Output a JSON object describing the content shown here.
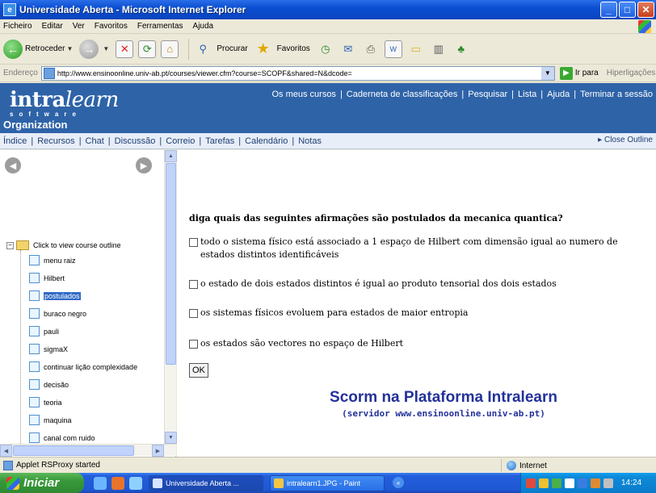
{
  "window": {
    "title": "Universidade Aberta - Microsoft Internet Explorer",
    "buttons": {
      "minimize": "_",
      "maximize": "□",
      "close": "✕"
    }
  },
  "menu": [
    "Ficheiro",
    "Editar",
    "Ver",
    "Favoritos",
    "Ferramentas",
    "Ajuda"
  ],
  "toolbar": {
    "back": "Retroceder",
    "search": "Procurar",
    "favorites": "Favoritos"
  },
  "address": {
    "label": "Endereço",
    "url": "http://www.ensinoonline.univ-ab.pt/courses/viewer.cfm?course=SCOPF&shared=N&dcode=",
    "go": "Ir para",
    "links": "Hiperligações"
  },
  "header": {
    "logo_main": "intra",
    "logo_italic": "learn",
    "logo_sub": "software",
    "section": "Organization",
    "nav": [
      "Os meus cursos",
      "Caderneta de classificações",
      "Pesquisar",
      "Lista",
      "Ajuda",
      "Terminar a sessão"
    ]
  },
  "toolnav": {
    "items": [
      "Índice",
      "Recursos",
      "Chat",
      "Discussão",
      "Correio",
      "Tarefas",
      "Calendário",
      "Notas"
    ],
    "close_outline": "Close Outline"
  },
  "outline": {
    "root": "Click to view course outline",
    "items": [
      {
        "label": "menu raiz",
        "selected": false
      },
      {
        "label": "Hilbert",
        "selected": false
      },
      {
        "label": "postulados",
        "selected": true
      },
      {
        "label": "buraco negro",
        "selected": false
      },
      {
        "label": "pauli",
        "selected": false
      },
      {
        "label": "sigmaX",
        "selected": false
      },
      {
        "label": "continuar lição complexidade",
        "selected": false
      },
      {
        "label": "decisão",
        "selected": false
      },
      {
        "label": "teoria",
        "selected": false
      },
      {
        "label": "maquina",
        "selected": false
      },
      {
        "label": "canal com ruido",
        "selected": false
      }
    ]
  },
  "quiz": {
    "question": "diga quais das seguintes afirmações são postulados da mecanica quantica?",
    "options": [
      "todo o sistema físico está associado a 1 espaço de Hilbert com dimensão igual ao numero de estados distintos identificáveis",
      "o estado de dois estados distintos é igual ao produto tensorial dos dois estados",
      "os sistemas físicos evoluem para estados de maior entropia",
      "os estados são vectores no espaço de Hilbert"
    ],
    "ok": "OK"
  },
  "promo": {
    "title": "Scorm na Plataforma Intralearn",
    "subtitle": "(servidor www.ensinoonline.univ-ab.pt)"
  },
  "status": {
    "text": "Applet RSProxy started",
    "zone": "Internet"
  },
  "taskbar": {
    "start": "Iniciar",
    "tasks": [
      "Universidade Aberta ...",
      "intralearn1.JPG - Paint"
    ],
    "clock": "14:24"
  },
  "colors": {
    "header_bg": "#2e63a8",
    "promo_text": "#23319a",
    "toolnav_bg": "#e8eef8"
  }
}
